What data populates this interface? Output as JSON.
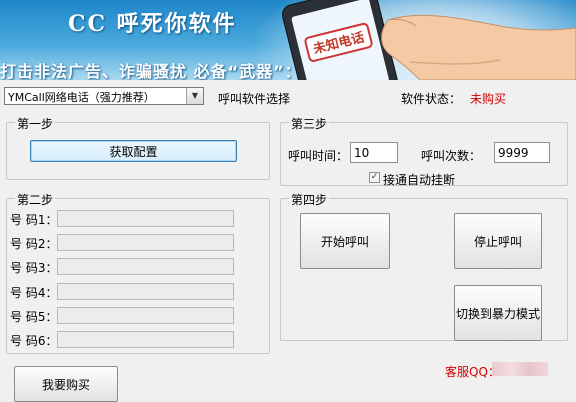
{
  "banner": {
    "title": "CC 呼死你软件",
    "slogan": "打击非法广告、诈骗骚扰 必备“武器”：",
    "phone_screen_text": "未知电话"
  },
  "top": {
    "service_select_value": "YMCall网络电话（强力推荐）",
    "service_select_label": "呼叫软件选择",
    "status_label": "软件状态：",
    "status_value": "未购买"
  },
  "step1": {
    "legend": "第一步",
    "get_config_label": "获取配置"
  },
  "step2": {
    "legend": "第二步",
    "numbers": [
      {
        "label": "号 码1：",
        "value": ""
      },
      {
        "label": "号 码2：",
        "value": ""
      },
      {
        "label": "号 码3：",
        "value": ""
      },
      {
        "label": "号 码4：",
        "value": ""
      },
      {
        "label": "号 码5：",
        "value": ""
      },
      {
        "label": "号 码6：",
        "value": ""
      }
    ]
  },
  "step3": {
    "legend": "第三步",
    "call_time_label": "呼叫时间：",
    "call_time_value": "10",
    "call_count_label": "呼叫次数：",
    "call_count_value": "9999",
    "auto_hangup_label": "接通自动挂断",
    "auto_hangup_checked": true
  },
  "step4": {
    "legend": "第四步",
    "start_label": "开始呼叫",
    "stop_label": "停止呼叫",
    "switch_label": "切换到暴力模式"
  },
  "footer": {
    "buy_label": "我要购买",
    "support_label": "客服QQ："
  },
  "colors": {
    "status": "#d40000",
    "support": "#d40000",
    "banner": "#2a8fd0"
  }
}
